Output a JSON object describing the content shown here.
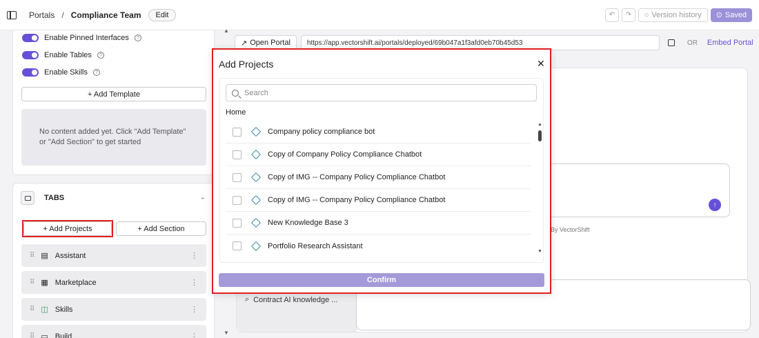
{
  "header": {
    "breadcrumb_root": "Portals",
    "breadcrumb_sep": "/",
    "breadcrumb_current": "Compliance Team",
    "edit_label": "Edit",
    "version_history_label": "Version history",
    "saved_label": "Saved"
  },
  "left": {
    "toggles": [
      {
        "label": "Enable Pinned Interfaces"
      },
      {
        "label": "Enable Tables"
      },
      {
        "label": "Enable Skills"
      }
    ],
    "add_template_label": "+ Add Template",
    "empty_text": "No content added yet. Click \"Add Template\" or \"Add Section\" to get started",
    "tabs_label": "TABS",
    "add_projects_label": "+ Add Projects",
    "add_section_label": "+ Add Section",
    "tab_items": [
      {
        "label": "Assistant"
      },
      {
        "label": "Marketplace"
      },
      {
        "label": "Skills"
      },
      {
        "label": "Build"
      }
    ]
  },
  "right": {
    "open_portal_label": "Open Portal",
    "url": "https://app.vectorshift.ai/portals/deployed/69b047a1f3afd0eb70b45d53",
    "or_label": "OR",
    "embed_label": "Embed Portal",
    "powered_label": "By VectorShift",
    "kb_item": "Contract AI knowledge ..."
  },
  "modal": {
    "title": "Add Projects",
    "search_placeholder": "Search",
    "home_label": "Home",
    "projects": [
      {
        "name": "Company policy compliance bot"
      },
      {
        "name": "Copy of Company Policy Compliance Chatbot"
      },
      {
        "name": "Copy of IMG -- Company Policy Compliance Chatbot"
      },
      {
        "name": "Copy of IMG -- Company Policy Compliance Chatbot"
      },
      {
        "name": "New Knowledge Base 3"
      },
      {
        "name": "Portfolio Research Assistant"
      }
    ],
    "confirm_label": "Confirm"
  },
  "colors": {
    "accent": "#6750d8",
    "confirm": "#a59ad8",
    "highlight": "#e02020"
  }
}
